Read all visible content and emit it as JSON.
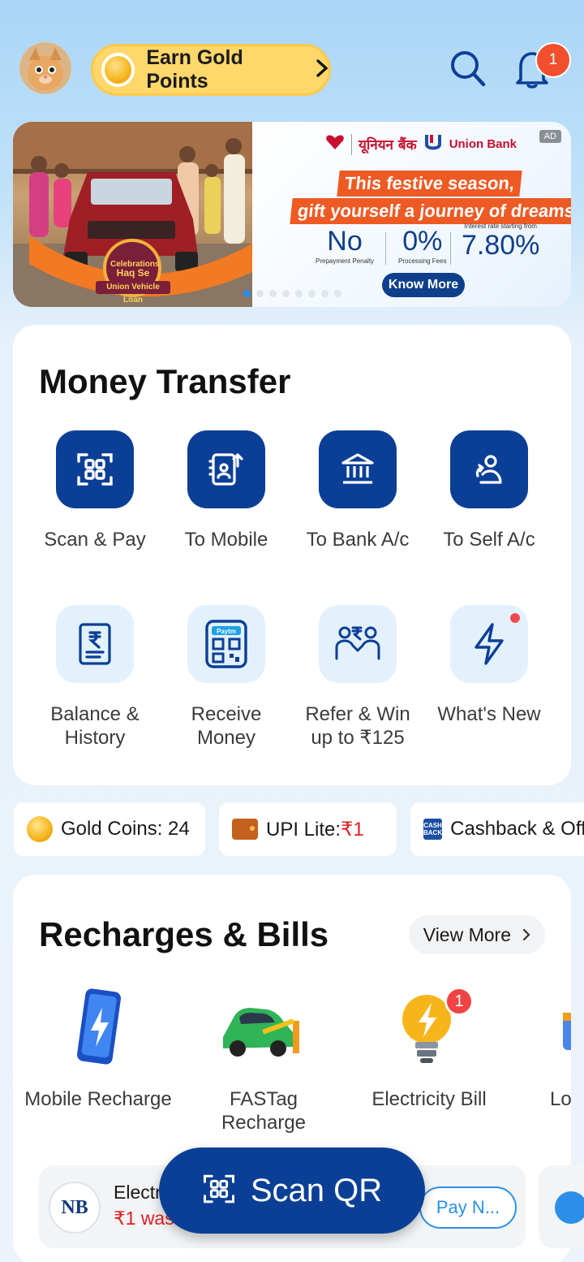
{
  "header": {
    "earn_label": "Earn Gold Points",
    "notification_count": "1"
  },
  "banner": {
    "ad_tag": "AD",
    "bank_name_hi": "यूनियन बैंक",
    "bank_name_en": "Union Bank",
    "headline_1": "This festive season,",
    "headline_2": "gift yourself a journey of dreams.",
    "stat_1_value": "No",
    "stat_1_caption": "Prepayment Penalty",
    "stat_2_value": "0%",
    "stat_2_caption": "Processing Fees",
    "stat_3_caption": "Interest rate starting from",
    "stat_3_value": "7.80%",
    "cta": "Know More",
    "photo_badge_1": "Celebrations",
    "photo_badge_2": "Haq Se",
    "photo_ribbon": "Union Vehicle Loan",
    "dot_count": 8,
    "active_dot": 0
  },
  "money_transfer": {
    "title": "Money Transfer",
    "tiles": [
      {
        "label": "Scan & Pay",
        "icon": "scan-icon"
      },
      {
        "label": "To Mobile",
        "icon": "contact-send-icon"
      },
      {
        "label": "To Bank A/c",
        "icon": "bank-icon"
      },
      {
        "label": "To Self A/c",
        "icon": "self-transfer-icon"
      },
      {
        "label": "Balance & History",
        "icon": "receipt-icon"
      },
      {
        "label": "Receive Money",
        "icon": "paytm-qr-icon"
      },
      {
        "label": "Refer & Win up to ₹125",
        "icon": "refer-icon"
      },
      {
        "label": "What's New",
        "icon": "lightning-icon"
      }
    ]
  },
  "chips": {
    "gold_coins": "Gold Coins: 24",
    "upi_lite_prefix": "UPI Lite:",
    "upi_lite_amount": "₹1",
    "cashback": "Cashback & Offers"
  },
  "recharges": {
    "title": "Recharges & Bills",
    "view_more": "View More",
    "tiles": [
      {
        "label": "Mobile Recharge",
        "icon": "mobile-recharge-icon"
      },
      {
        "label": "FASTag Recharge",
        "icon": "fastag-car-icon"
      },
      {
        "label": "Electricity Bill",
        "icon": "bulb-icon",
        "badge": "1"
      },
      {
        "label": "Loan Payment",
        "icon": "loan-icon"
      }
    ],
    "bill": {
      "logo_text": "NB",
      "name": "Electricity",
      "sub": "₹1 was",
      "pay_label": "Pay N..."
    }
  },
  "scan_qr": {
    "label": "Scan QR"
  },
  "colors": {
    "primary": "#0b3f96",
    "accent_blue": "#2b8fe8",
    "gold_pill": "#ffd76a",
    "badge_red": "#f24f2e"
  }
}
